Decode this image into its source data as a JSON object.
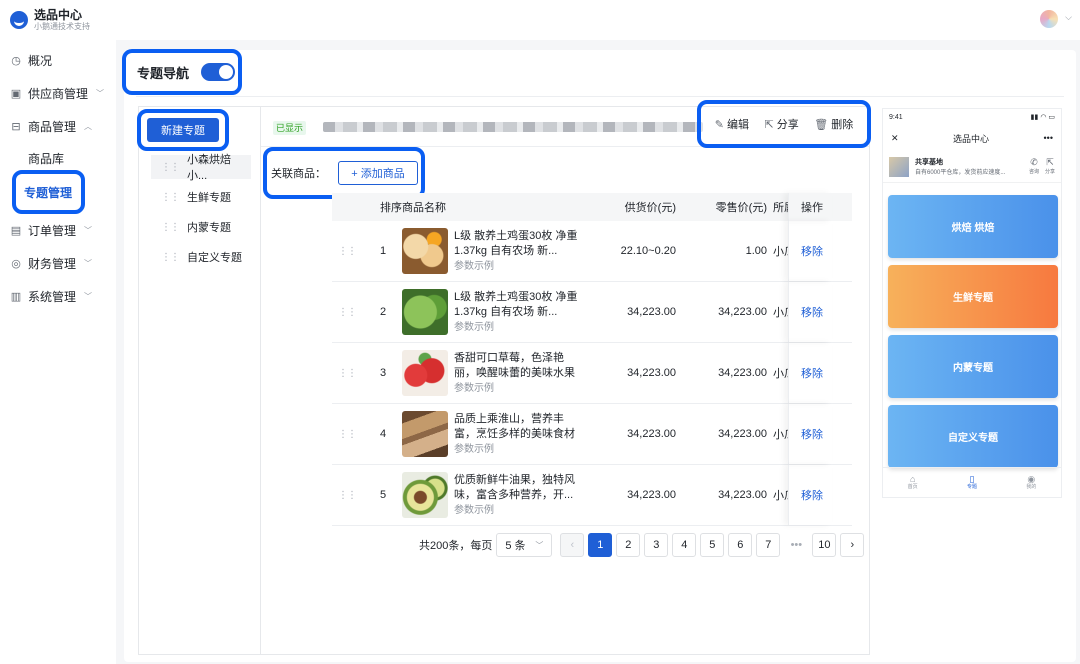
{
  "brand": {
    "title": "选品中心",
    "subtitle": "小鹅通技术支持"
  },
  "sidebar": {
    "items": [
      {
        "label": "概况",
        "icon": "overview-icon"
      },
      {
        "label": "供应商管理",
        "icon": "supplier-icon"
      },
      {
        "label": "商品管理",
        "icon": "product-icon"
      },
      {
        "label": "订单管理",
        "icon": "order-icon"
      },
      {
        "label": "财务管理",
        "icon": "finance-icon"
      },
      {
        "label": "系统管理",
        "icon": "system-icon"
      }
    ],
    "sub_items": [
      {
        "label": "商品库"
      },
      {
        "label": "专题管理"
      }
    ]
  },
  "toggle": {
    "label": "专题导航",
    "on": true
  },
  "topics": {
    "new_button": "新建专题",
    "items": [
      "小森烘焙小...",
      "生鲜专题",
      "内蒙专题",
      "自定义专题"
    ]
  },
  "detail": {
    "status_tag": "已显示",
    "actions": {
      "edit": "编辑",
      "share": "分享",
      "delete": "删除"
    },
    "related_label": "关联商品：",
    "add_button": "+ 添加商品"
  },
  "table": {
    "headers": {
      "no": "排序",
      "name": "商品名称",
      "supply": "供货价(元)",
      "retail": "零售价(元)",
      "owner": "所属",
      "op": "操作"
    },
    "rows": [
      {
        "no": "1",
        "title": "L级 散养土鸡蛋30枚 净重1.37kg 自有农场 新...",
        "sub": "参数示例",
        "supply": "22.10~0.20",
        "retail": "1.00",
        "owner": "小瓜",
        "op": "移除",
        "img": "eggs"
      },
      {
        "no": "2",
        "title": "L级 散养土鸡蛋30枚 净重1.37kg 自有农场 新...",
        "sub": "参数示例",
        "supply": "34,223.00",
        "retail": "34,223.00",
        "owner": "小瓜",
        "op": "移除",
        "img": "lettuce"
      },
      {
        "no": "3",
        "title": "香甜可口草莓，色泽艳丽，唤醒味蕾的美味水果",
        "sub": "参数示例",
        "supply": "34,223.00",
        "retail": "34,223.00",
        "owner": "小瓜",
        "op": "移除",
        "img": "strawberry"
      },
      {
        "no": "4",
        "title": "品质上乘淮山，营养丰富，烹饪多样的美味食材",
        "sub": "参数示例",
        "supply": "34,223.00",
        "retail": "34,223.00",
        "owner": "小瓜",
        "op": "移除",
        "img": "yam"
      },
      {
        "no": "5",
        "title": "优质新鲜牛油果，独特风味，富含多种营养，开...",
        "sub": "参数示例",
        "supply": "34,223.00",
        "retail": "34,223.00",
        "owner": "小瓜",
        "op": "移除",
        "img": "avocado"
      }
    ]
  },
  "pager": {
    "total": "共200条，每页",
    "size": "5 条",
    "pages": [
      "1",
      "2",
      "3",
      "4",
      "5",
      "6",
      "7"
    ],
    "ellipsis": "•••",
    "last": "10",
    "current": "1"
  },
  "phone": {
    "time": "9:41",
    "title": "选品中心",
    "shop_name": "共享基地",
    "shop_desc": "自有6000平仓库，发货前应速度...",
    "call_label": "咨询",
    "share_label": "分享",
    "cards": [
      "烘焙 烘焙",
      "生鲜专题",
      "内蒙专题",
      "自定义专题"
    ],
    "tabs": [
      "首页",
      "专题",
      "我的"
    ]
  },
  "colors": {
    "accent": "#1f5fd6",
    "highlight": "#0a5ef2"
  }
}
